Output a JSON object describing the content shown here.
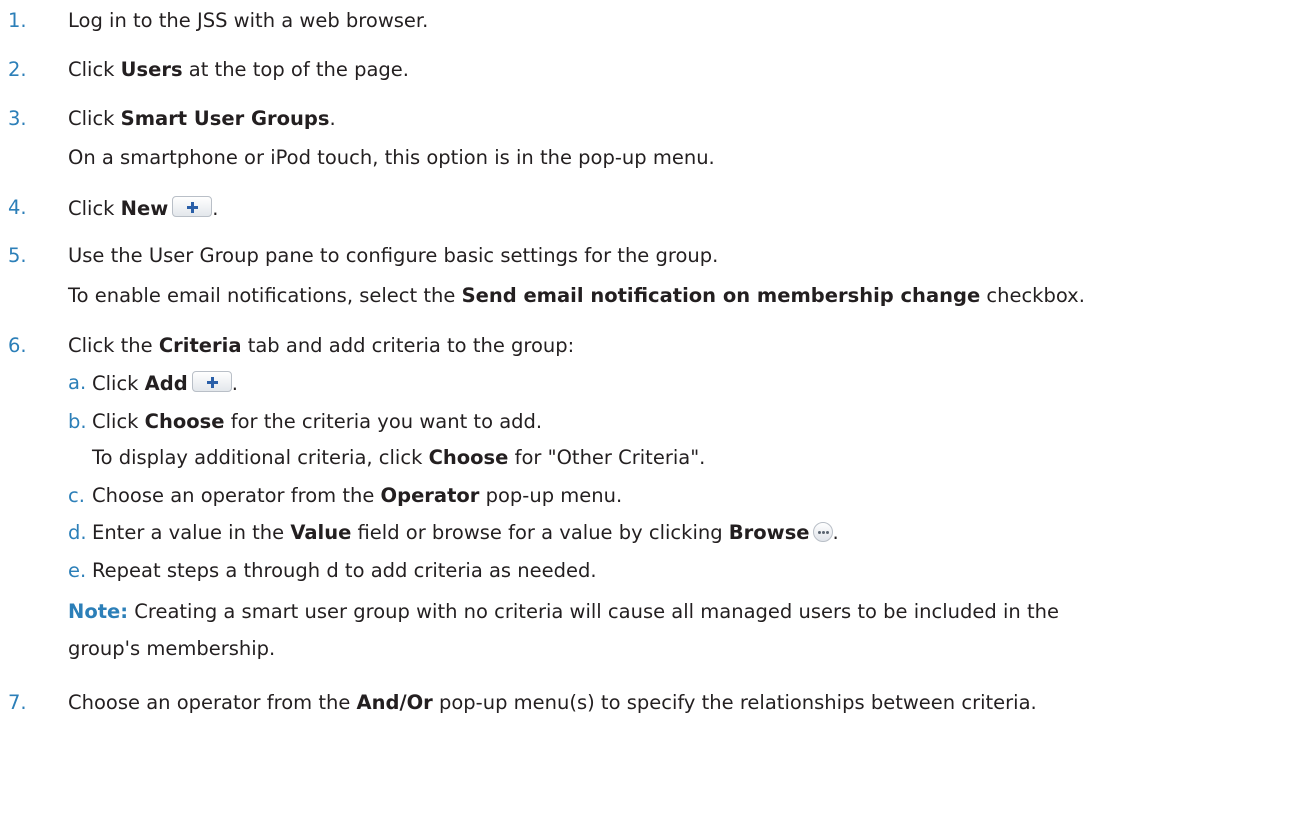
{
  "steps": [
    {
      "num": "1.",
      "parts": [
        "Log in to the JSS with a web browser."
      ]
    },
    {
      "num": "2.",
      "pre": "Click ",
      "bold": "Users",
      "post": " at the top of the page."
    },
    {
      "num": "3.",
      "pre": "Click ",
      "bold": "Smart User Groups",
      "post": ".",
      "cont": "On a smartphone or iPod touch, this option is in the pop-up menu."
    },
    {
      "num": "4.",
      "pre": "Click ",
      "bold": "New",
      "post": "."
    },
    {
      "num": "5.",
      "text": "Use the User Group pane to configure basic settings for the group.",
      "cont_pre": "To enable email notifications, select the ",
      "cont_bold": "Send email notification on membership change",
      "cont_post": " checkbox."
    },
    {
      "num": "6.",
      "pre": "Click the ",
      "bold": "Criteria",
      "post": " tab and add criteria to the group:"
    },
    {
      "num": "7.",
      "pre": "Choose an operator from the ",
      "bold": "And/Or",
      "post": " pop-up menu(s) to specify the relationships between criteria."
    }
  ],
  "substeps": [
    {
      "num": "a.",
      "pre": "Click ",
      "bold": "Add",
      "post": "."
    },
    {
      "num": "b.",
      "pre": "Click ",
      "bold": "Choose",
      "post": " for the criteria you want to add.",
      "cont_pre": "To display additional criteria, click ",
      "cont_bold": "Choose",
      "cont_post": " for \"Other Criteria\"."
    },
    {
      "num": "c.",
      "pre": "Choose an operator from the ",
      "bold": "Operator",
      "post": " pop-up menu."
    },
    {
      "num": "d.",
      "pre": "Enter a value in the ",
      "bold": "Value",
      "mid": " field or browse for a value by clicking ",
      "bold2": "Browse",
      "post": "."
    },
    {
      "num": "e.",
      "text": "Repeat steps a through d to add criteria as needed."
    }
  ],
  "note": {
    "label": "Note:",
    "line1": " Creating a smart user group with no criteria will cause all managed users to be included in the",
    "line2": "group's membership."
  },
  "icons": {
    "plus": "plus-icon",
    "browse": "ellipsis-icon"
  },
  "colors": {
    "accent": "#2c7fb8",
    "text": "#231f20"
  }
}
